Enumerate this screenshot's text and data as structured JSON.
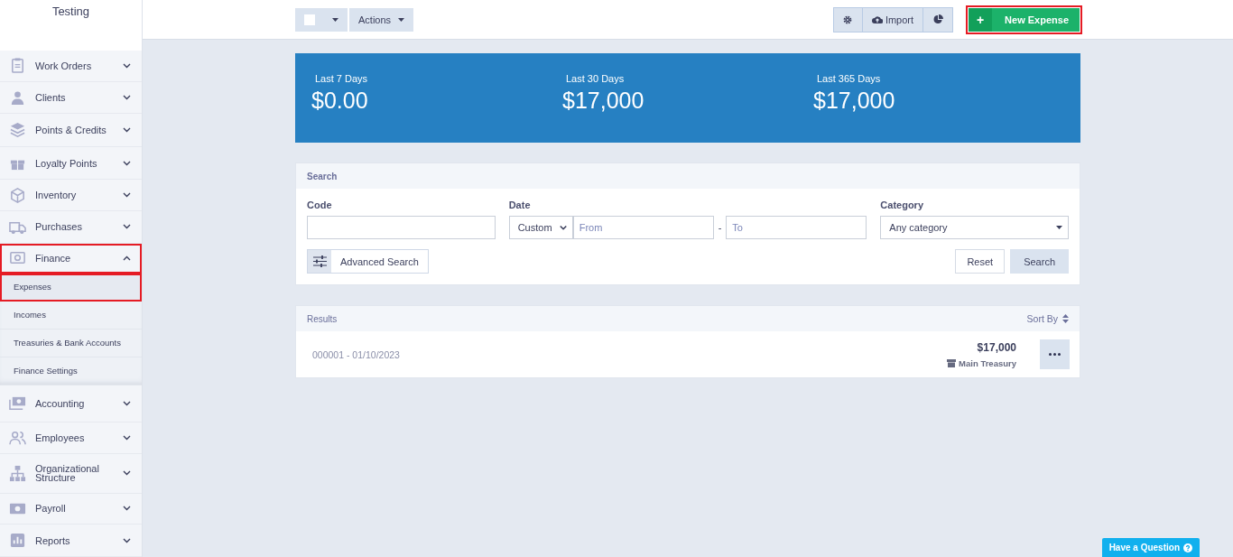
{
  "sidebar": {
    "title": "Testing",
    "items": [
      {
        "label": "Work Orders",
        "expanded": false,
        "highlighted": false
      },
      {
        "label": "Clients",
        "expanded": false,
        "highlighted": false
      },
      {
        "label": "Points & Credits",
        "expanded": false,
        "highlighted": false
      },
      {
        "label": "Loyalty Points",
        "expanded": false,
        "highlighted": false
      },
      {
        "label": "Inventory",
        "expanded": false,
        "highlighted": false
      },
      {
        "label": "Purchases",
        "expanded": false,
        "highlighted": false
      },
      {
        "label": "Finance",
        "expanded": true,
        "highlighted": true,
        "children": [
          {
            "label": "Expenses",
            "selected": true,
            "highlighted": true
          },
          {
            "label": "Incomes",
            "selected": false,
            "highlighted": false
          },
          {
            "label": "Treasuries & Bank Accounts",
            "selected": false,
            "highlighted": false
          },
          {
            "label": "Finance Settings",
            "selected": false,
            "highlighted": false
          }
        ]
      },
      {
        "label": "Accounting",
        "expanded": false,
        "highlighted": false
      },
      {
        "label": "Employees",
        "expanded": false,
        "highlighted": false
      },
      {
        "label": "Organizational Structure",
        "expanded": false,
        "highlighted": false
      },
      {
        "label": "Payroll",
        "expanded": false,
        "highlighted": false
      },
      {
        "label": "Reports",
        "expanded": false,
        "highlighted": false
      }
    ]
  },
  "toolbar": {
    "select_all": {
      "checked": false
    },
    "actions": "Actions",
    "import": "Import",
    "new_button": {
      "icon": "+",
      "label": "New Expense",
      "highlighted": true
    }
  },
  "stats": [
    {
      "label": "Last 7 Days",
      "value": "$0.00"
    },
    {
      "label": "Last 30 Days",
      "value": "$17,000"
    },
    {
      "label": "Last 365 Days",
      "value": "$17,000"
    }
  ],
  "search": {
    "title": "Search",
    "code_label": "Code",
    "date_label": "Date",
    "date_mode": "Custom",
    "from_placeholder": "From",
    "separator": "-",
    "to_placeholder": "To",
    "category_label": "Category",
    "category": "Any category",
    "advanced": "Advanced Search",
    "reset": "Reset",
    "submit": "Search"
  },
  "results": {
    "title": "Results",
    "sort": "Sort By",
    "rows": [
      {
        "code_date": "000001 - 01/10/2023",
        "amount": "$17,000",
        "treasury": "Main Treasury"
      }
    ]
  },
  "help_button": "Have a Question"
}
